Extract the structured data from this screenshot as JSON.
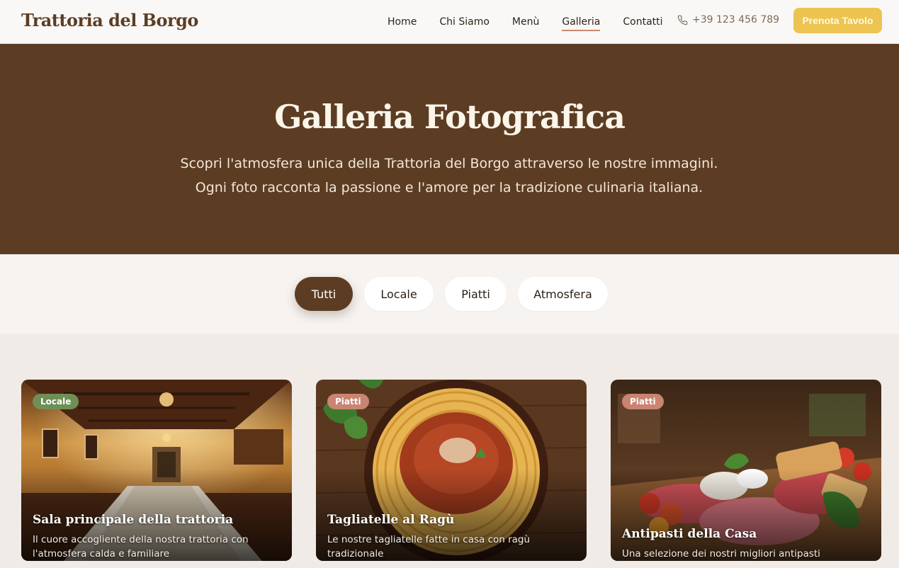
{
  "header": {
    "logo": "Trattoria del Borgo",
    "nav": [
      "Home",
      "Chi Siamo",
      "Menù",
      "Galleria",
      "Contatti"
    ],
    "active_nav": "Galleria",
    "phone": "+39 123 456 789",
    "cta": "Prenota Tavolo"
  },
  "hero": {
    "title": "Galleria Fotografica",
    "subtitle": "Scopri l'atmosfera unica della Trattoria del Borgo attraverso le nostre immagini. Ogni foto racconta la passione e l'amore per la tradizione culinaria italiana."
  },
  "filters": [
    "Tutti",
    "Locale",
    "Piatti",
    "Atmosfera"
  ],
  "active_filter": "Tutti",
  "gallery": [
    {
      "badge": "Locale",
      "title": "Sala principale della trattoria",
      "description": "Il cuore accogliente della nostra trattoria con l'atmosfera calda e familiare"
    },
    {
      "badge": "Piatti",
      "title": "Tagliatelle al Ragù",
      "description": "Le nostre tagliatelle fatte in casa con ragù tradizionale"
    },
    {
      "badge": "Piatti",
      "title": "Antipasti della Casa",
      "description": "Una selezione dei nostri migliori antipasti tradizionali"
    }
  ],
  "colors": {
    "brand_brown": "#5c3d23",
    "cta_yellow": "#ecc44f",
    "badge_locale": "#6f8f55",
    "badge_piatti": "#c98472",
    "nav_underline": "#c98a6c"
  },
  "icons": {
    "phone": "phone-icon"
  }
}
